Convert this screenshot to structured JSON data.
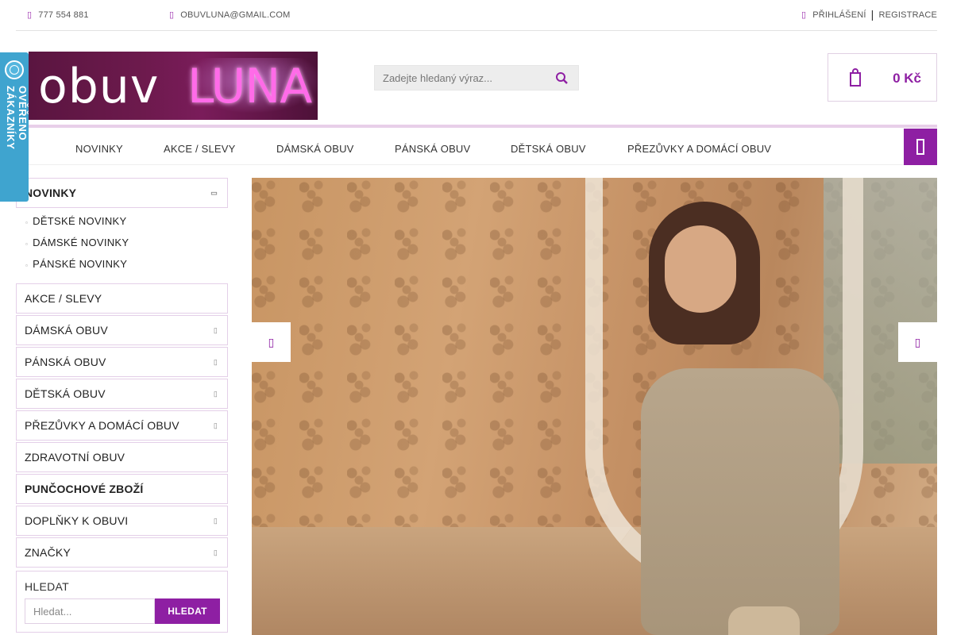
{
  "topbar": {
    "phone": "777 554 881",
    "email": "OBUVLUNA@GMAIL.COM",
    "login": "PŘIHLÁŠENÍ",
    "register": "REGISTRACE"
  },
  "badge": {
    "text": "OVĚŘENO ZÁKAZNÍKY"
  },
  "logo": {
    "word1": "obuv",
    "word2": "LUNA"
  },
  "search": {
    "placeholder": "Zadejte hledaný výraz..."
  },
  "cart": {
    "total": "0 Kč"
  },
  "nav": {
    "items": [
      "NOVINKY",
      "AKCE / SLEVY",
      "DÁMSKÁ OBUV",
      "PÁNSKÁ OBUV",
      "DĚTSKÁ OBUV",
      "PŘEZŮVKY A DOMÁCÍ OBUV"
    ]
  },
  "sidebar": {
    "active": "NOVINKY",
    "subitems": [
      "DĚTSKÉ NOVINKY",
      "DÁMSKÉ NOVINKY",
      "PÁNSKÉ NOVINKY"
    ],
    "categories": [
      {
        "label": "AKCE / SLEVY"
      },
      {
        "label": "DÁMSKÁ OBUV"
      },
      {
        "label": "PÁNSKÁ OBUV"
      },
      {
        "label": "DĚTSKÁ OBUV"
      },
      {
        "label": "PŘEZŮVKY A DOMÁCÍ OBUV"
      },
      {
        "label": "ZDRAVOTNÍ OBUV"
      },
      {
        "label": "PUNČOCHOVÉ ZBOŽÍ"
      },
      {
        "label": "DOPLŇKY K OBUVI"
      },
      {
        "label": "ZNAČKY"
      }
    ]
  },
  "search_box": {
    "title": "HLEDAT",
    "placeholder": "Hledat...",
    "button": "HLEDAT"
  },
  "colors": {
    "accent": "#8e1fa3",
    "badge": "#3fa4cf"
  }
}
